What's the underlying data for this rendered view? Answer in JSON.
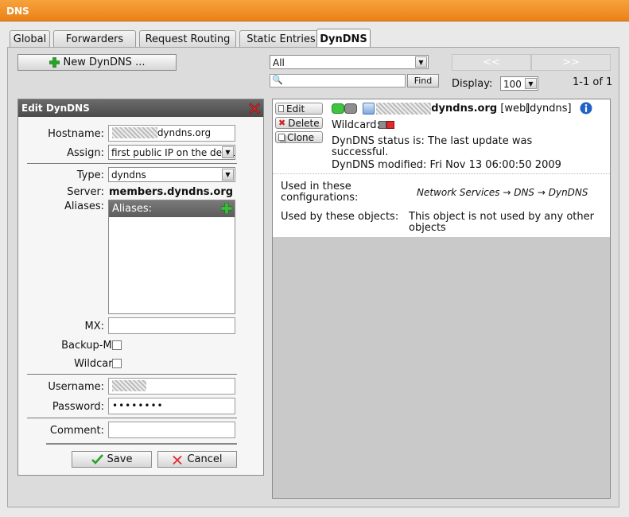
{
  "window": {
    "title": "DNS"
  },
  "tabs": [
    {
      "label": "Global"
    },
    {
      "label": "Forwarders"
    },
    {
      "label": "Request Routing"
    },
    {
      "label": "Static Entries"
    },
    {
      "label": "DynDNS",
      "active": true
    }
  ],
  "toolbar": {
    "new_button_label": "New DynDNS ...",
    "filter_selected": "All",
    "search_value": "",
    "find_label": "Find",
    "display_label": "Display:",
    "display_value": "100",
    "pager_prev": "<<",
    "pager_next": ">>",
    "count_text": "1-1 of 1"
  },
  "edit_form": {
    "title": "Edit DynDNS",
    "hostname_label": "Hostname:",
    "hostname_value": "dyndns.org",
    "assign_label": "Assign:",
    "assign_value": "first public IP on the default interface",
    "type_label": "Type:",
    "type_value": "dyndns",
    "server_label": "Server:",
    "server_value": "members.dyndns.org",
    "aliases_label": "Aliases:",
    "aliases_header": "Aliases:",
    "mx_label": "MX:",
    "mx_value": "",
    "backup_mx_label": "Backup-MX:",
    "backup_mx_checked": false,
    "wildcard_label": "Wildcard:",
    "wildcard_checked": false,
    "username_label": "Username:",
    "username_value": "",
    "password_label": "Password:",
    "password_value": "••••••••",
    "comment_label": "Comment:",
    "comment_value": "",
    "save_label": "Save",
    "cancel_label": "Cancel"
  },
  "entry": {
    "edit_label": "Edit",
    "delete_label": "Delete",
    "clone_label": "Clone",
    "hostname": "dyndns.org",
    "tag_web": "[web]",
    "tag_type": "[dyndns]",
    "wildcard_label": "Wildcard:",
    "status_line1": "DynDNS status is: The last update was",
    "status_line2": "successful.",
    "modified": "DynDNS modified: Fri Nov 13 06:00:50 2009",
    "used_in_label_1": "Used in these",
    "used_in_label_2": "configurations:",
    "used_in_path": "Network Services → DNS → DynDNS",
    "used_by_label": "Used by these objects:",
    "used_by_value_1": "This object is not used by any other",
    "used_by_value_2": "objects"
  },
  "colors": {
    "titlebar": "#ea8217",
    "accent_green": "#2aa12a",
    "accent_red": "#d42020"
  }
}
